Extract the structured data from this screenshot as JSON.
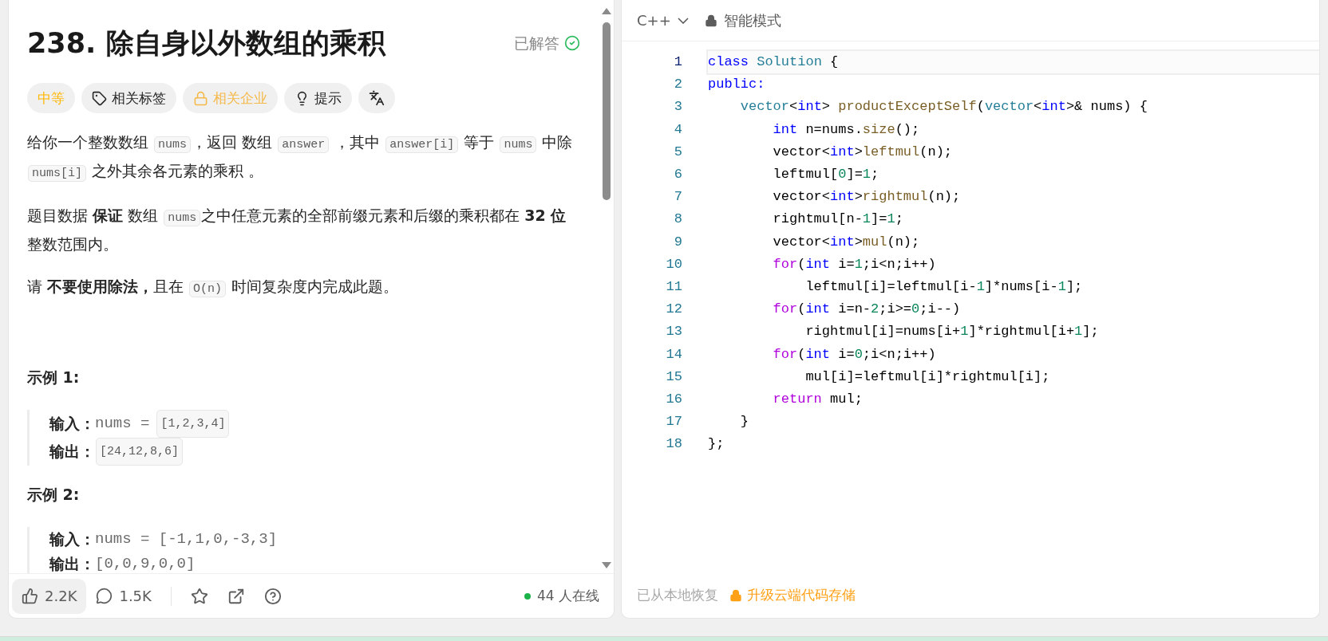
{
  "problem": {
    "title": "238. 除自身以外数组的乘积",
    "status": "已解答",
    "solved": true,
    "tags": [
      {
        "kind": "difficulty",
        "label": "中等"
      },
      {
        "kind": "tag",
        "label": "相关标签"
      },
      {
        "kind": "company",
        "label": "相关企业"
      },
      {
        "kind": "hint",
        "label": "提示"
      },
      {
        "kind": "translate"
      }
    ],
    "paragraphs": [
      [
        {
          "kind": "text",
          "text": "给你一个整数数组 "
        },
        {
          "kind": "code",
          "text": "nums"
        },
        {
          "kind": "text",
          "text": "，返回 数组 "
        },
        {
          "kind": "code",
          "text": "answer"
        },
        {
          "kind": "text",
          "text": " ，其中 "
        },
        {
          "kind": "code",
          "text": "answer[i]"
        },
        {
          "kind": "text",
          "text": " 等于 "
        },
        {
          "kind": "code",
          "text": "nums"
        },
        {
          "kind": "text",
          "text": " 中除 "
        },
        {
          "kind": "code",
          "text": "nums[i]"
        },
        {
          "kind": "text",
          "text": " 之外其余各元素的乘积 。"
        }
      ],
      [
        {
          "kind": "text",
          "text": "题目数据 "
        },
        {
          "kind": "bold",
          "text": "保证"
        },
        {
          "kind": "text",
          "text": " 数组 "
        },
        {
          "kind": "code",
          "text": "nums"
        },
        {
          "kind": "text",
          "text": "之中任意元素的全部前缀元素和后缀的乘积都在 "
        },
        {
          "kind": "bold",
          "text": "32 位"
        },
        {
          "kind": "text",
          "text": " 整数范围内。"
        }
      ],
      [
        {
          "kind": "text",
          "text": "请 "
        },
        {
          "kind": "bold",
          "text": "不要使用除法，"
        },
        {
          "kind": "text",
          "text": "且在 "
        },
        {
          "kind": "code",
          "text": "O(n)"
        },
        {
          "kind": "text",
          "text": " 时间复杂度内完成此题。"
        }
      ]
    ],
    "examples": [
      {
        "title": "示例 1:",
        "lines": [
          [
            {
              "kind": "label",
              "text": "输入："
            },
            {
              "kind": "mono",
              "text": "nums ="
            },
            {
              "kind": "code",
              "text": "[1,2,3,4]"
            }
          ],
          [
            {
              "kind": "label",
              "text": "输出："
            },
            {
              "kind": "code",
              "text": "[24,12,8,6]"
            }
          ]
        ]
      },
      {
        "title": "示例 2:",
        "lines": [
          [
            {
              "kind": "label",
              "text": "输入："
            },
            {
              "kind": "mono",
              "text": "nums = [-1,1,0,-3,3]"
            }
          ],
          [
            {
              "kind": "label",
              "text": "输出："
            },
            {
              "kind": "mono",
              "text": "[0,0,9,0,0]"
            }
          ]
        ]
      }
    ]
  },
  "footer": {
    "likes": "2.2K",
    "liked": true,
    "comments": "1.5K",
    "online": "44 人在线"
  },
  "editor": {
    "language": "C++",
    "mode": "智能模式",
    "lines": [
      [
        {
          "kind": "kw",
          "text": "class"
        },
        {
          "kind": "ty",
          "text": " Solution"
        },
        {
          "kind": "p",
          "text": " {"
        }
      ],
      [
        {
          "kind": "kw",
          "text": "public:"
        }
      ],
      [
        {
          "kind": "ty",
          "text": "    vector"
        },
        {
          "kind": "p",
          "text": "<"
        },
        {
          "kind": "kw",
          "text": "int"
        },
        {
          "kind": "p",
          "text": "> "
        },
        {
          "kind": "fn",
          "text": "productExceptSelf"
        },
        {
          "kind": "p",
          "text": "("
        },
        {
          "kind": "ty",
          "text": "vector"
        },
        {
          "kind": "p",
          "text": "<"
        },
        {
          "kind": "kw",
          "text": "int"
        },
        {
          "kind": "p",
          "text": ">& nums) {"
        }
      ],
      [
        {
          "kind": "kw",
          "text": "        int"
        },
        {
          "kind": "p",
          "text": " n=nums."
        },
        {
          "kind": "fn",
          "text": "size"
        },
        {
          "kind": "p",
          "text": "();"
        }
      ],
      [
        {
          "kind": "p",
          "text": "        vector<"
        },
        {
          "kind": "kw",
          "text": "int"
        },
        {
          "kind": "p",
          "text": ">"
        },
        {
          "kind": "fn",
          "text": "leftmul"
        },
        {
          "kind": "p",
          "text": "(n);"
        }
      ],
      [
        {
          "kind": "p",
          "text": "        leftmul["
        },
        {
          "kind": "num",
          "text": "0"
        },
        {
          "kind": "p",
          "text": "]="
        },
        {
          "kind": "num",
          "text": "1"
        },
        {
          "kind": "p",
          "text": ";"
        }
      ],
      [
        {
          "kind": "p",
          "text": "        vector<"
        },
        {
          "kind": "kw",
          "text": "int"
        },
        {
          "kind": "p",
          "text": ">"
        },
        {
          "kind": "fn",
          "text": "rightmul"
        },
        {
          "kind": "p",
          "text": "(n);"
        }
      ],
      [
        {
          "kind": "p",
          "text": "        rightmul[n-"
        },
        {
          "kind": "num",
          "text": "1"
        },
        {
          "kind": "p",
          "text": "]="
        },
        {
          "kind": "num",
          "text": "1"
        },
        {
          "kind": "p",
          "text": ";"
        }
      ],
      [
        {
          "kind": "p",
          "text": "        vector<"
        },
        {
          "kind": "kw",
          "text": "int"
        },
        {
          "kind": "p",
          "text": ">"
        },
        {
          "kind": "fn",
          "text": "mul"
        },
        {
          "kind": "p",
          "text": "(n);"
        }
      ],
      [
        {
          "kind": "ctl",
          "text": "        for"
        },
        {
          "kind": "p",
          "text": "("
        },
        {
          "kind": "kw",
          "text": "int"
        },
        {
          "kind": "p",
          "text": " i="
        },
        {
          "kind": "num",
          "text": "1"
        },
        {
          "kind": "p",
          "text": ";i<n;i++)"
        }
      ],
      [
        {
          "kind": "p",
          "text": "            leftmul[i]=leftmul[i-"
        },
        {
          "kind": "num",
          "text": "1"
        },
        {
          "kind": "p",
          "text": "]*nums[i-"
        },
        {
          "kind": "num",
          "text": "1"
        },
        {
          "kind": "p",
          "text": "];"
        }
      ],
      [
        {
          "kind": "ctl",
          "text": "        for"
        },
        {
          "kind": "p",
          "text": "("
        },
        {
          "kind": "kw",
          "text": "int"
        },
        {
          "kind": "p",
          "text": " i=n-"
        },
        {
          "kind": "num",
          "text": "2"
        },
        {
          "kind": "p",
          "text": ";i>="
        },
        {
          "kind": "num",
          "text": "0"
        },
        {
          "kind": "p",
          "text": ";i--)"
        }
      ],
      [
        {
          "kind": "p",
          "text": "            rightmul[i]=nums[i+"
        },
        {
          "kind": "num",
          "text": "1"
        },
        {
          "kind": "p",
          "text": "]*rightmul[i+"
        },
        {
          "kind": "num",
          "text": "1"
        },
        {
          "kind": "p",
          "text": "];"
        }
      ],
      [
        {
          "kind": "ctl",
          "text": "        for"
        },
        {
          "kind": "p",
          "text": "("
        },
        {
          "kind": "kw",
          "text": "int"
        },
        {
          "kind": "p",
          "text": " i="
        },
        {
          "kind": "num",
          "text": "0"
        },
        {
          "kind": "p",
          "text": ";i<n;i++)"
        }
      ],
      [
        {
          "kind": "p",
          "text": "            mul[i]=leftmul[i]*rightmul[i];"
        }
      ],
      [
        {
          "kind": "ctl",
          "text": "        return"
        },
        {
          "kind": "p",
          "text": " mul;"
        }
      ],
      [
        {
          "kind": "p",
          "text": "    }"
        }
      ],
      [
        {
          "kind": "p",
          "text": "};"
        }
      ]
    ],
    "line_numbers": [
      "1",
      "2",
      "3",
      "4",
      "5",
      "6",
      "7",
      "8",
      "9",
      "10",
      "11",
      "12",
      "13",
      "14",
      "15",
      "16",
      "17",
      "18"
    ],
    "restored": "已从本地恢复",
    "upgrade": "升级云端代码存储"
  }
}
